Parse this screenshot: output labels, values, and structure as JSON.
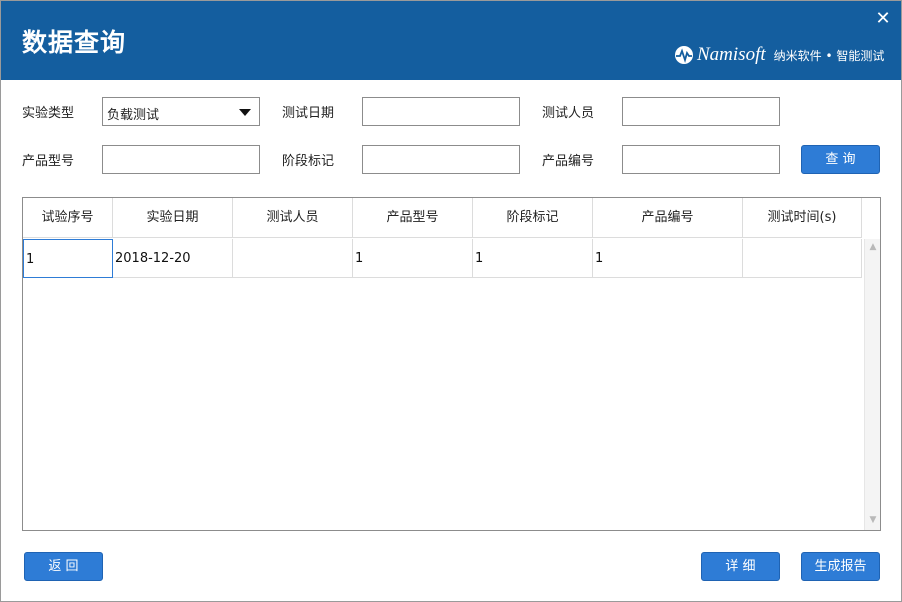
{
  "window": {
    "title": "数据查询"
  },
  "brand": {
    "name": "Namisoft",
    "slogan": "纳米软件 • 智能测试"
  },
  "form": {
    "experiment_type": {
      "label": "实验类型",
      "value": "负载测试"
    },
    "test_date": {
      "label": "测试日期",
      "value": ""
    },
    "tester": {
      "label": "测试人员",
      "value": ""
    },
    "product_model": {
      "label": "产品型号",
      "value": ""
    },
    "stage_mark": {
      "label": "阶段标记",
      "value": ""
    },
    "product_number": {
      "label": "产品编号",
      "value": ""
    },
    "query_label": "查 询"
  },
  "table": {
    "columns": [
      "试验序号",
      "实验日期",
      "测试人员",
      "产品型号",
      "阶段标记",
      "产品编号",
      "测试时间(s)"
    ],
    "rows": [
      [
        "1",
        "2018-12-20",
        "",
        "1",
        "1",
        "1",
        ""
      ]
    ]
  },
  "footer": {
    "back_label": "返 回",
    "detail_label": "详 细",
    "report_label": "生成报告"
  },
  "colors": {
    "titlebar": "#145e9f",
    "button": "#2e7cd6"
  },
  "icons": {
    "close": "close-icon",
    "logo": "namisoft-logo-icon",
    "select": "dropdown-arrow-icon"
  }
}
